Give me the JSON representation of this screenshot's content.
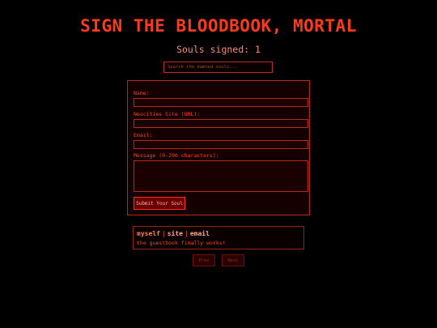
{
  "header": {
    "title": "SIGN THE BLOODBOOK, MORTAL",
    "souls_signed": "Souls signed: 1"
  },
  "search": {
    "placeholder": "Search the damned souls..."
  },
  "form": {
    "name_label": "Name:",
    "site_label": "Neocities Site (URL):",
    "email_label": "Email:",
    "message_label": "Message (0-200 characters):",
    "name_value": "",
    "site_value": "",
    "email_value": "",
    "message_value": "",
    "submit_label": "Submit Your Soul"
  },
  "entries": [
    {
      "name": "myself",
      "separator": "|",
      "site_label": "site",
      "email_label": "email",
      "message": "the guestbook finally works!"
    }
  ],
  "pagination": {
    "prev_label": "Prev",
    "next_label": "Next"
  },
  "colors": {
    "background": "#000000",
    "accent": "#ff3a1a",
    "border": "#b8281a"
  }
}
